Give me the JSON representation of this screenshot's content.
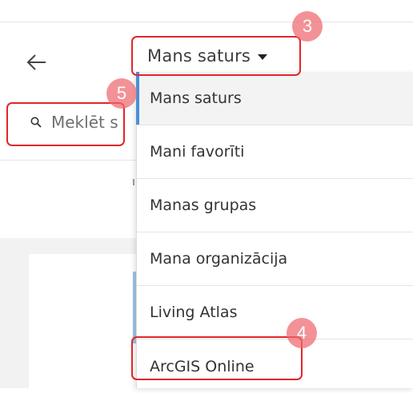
{
  "header": {
    "back_label": "Back",
    "dropdown_label": "Mans saturs"
  },
  "search": {
    "placeholder": "Meklēt s"
  },
  "menu": {
    "items": [
      {
        "label": "Mans saturs",
        "selected": true
      },
      {
        "label": "Mani favorīti"
      },
      {
        "label": "Manas grupas"
      },
      {
        "label": "Mana organizācija"
      },
      {
        "label": "Living Atlas"
      },
      {
        "label": "ArcGIS Online"
      }
    ]
  },
  "annotations": {
    "badge_dropdown": "3",
    "badge_arcgis": "4",
    "badge_search": "5",
    "highlight_color": "#e0262b",
    "badge_color": "#ee686e"
  },
  "colors": {
    "selected_indicator": "#4a90d9",
    "selected_background": "#f3f3f3"
  }
}
